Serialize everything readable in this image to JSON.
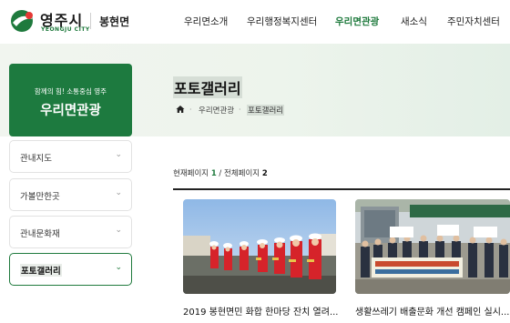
{
  "site": {
    "logo_text": "영주시",
    "logo_sub": "YEONGJU CITY",
    "town": "봉현면",
    "brand_color": "#1f7a3d"
  },
  "gnb": [
    {
      "label": "우리면소개",
      "active": false
    },
    {
      "label": "우리행정복지센터",
      "active": false
    },
    {
      "label": "우리면관광",
      "active": true
    },
    {
      "label": "새소식",
      "active": false
    },
    {
      "label": "주민자치센터",
      "active": false
    }
  ],
  "side": {
    "slogan": "함께의 힘! 소통중심 영주",
    "title": "우리면관광",
    "menu": [
      {
        "label": "관내지도",
        "active": false
      },
      {
        "label": "가볼만한곳",
        "active": false
      },
      {
        "label": "관내문화재",
        "active": false
      },
      {
        "label": "포토갤러리",
        "active": true
      }
    ]
  },
  "page": {
    "title": "포토갤러리",
    "breadcrumb": [
      "우리면관광",
      "포토갤러리"
    ]
  },
  "paging": {
    "current_label": "현재페이지",
    "current": "1",
    "sep": " / ",
    "total_label": "전체페이지",
    "total": "2"
  },
  "gallery": [
    {
      "title": "2019 봉현면민 화합 한마당 잔치 열려...",
      "thumb_icon": "band-performance-photo"
    },
    {
      "title": "생활쓰레기 배출문화 개선 캠페인 실시...",
      "thumb_icon": "campaign-group-photo"
    }
  ]
}
